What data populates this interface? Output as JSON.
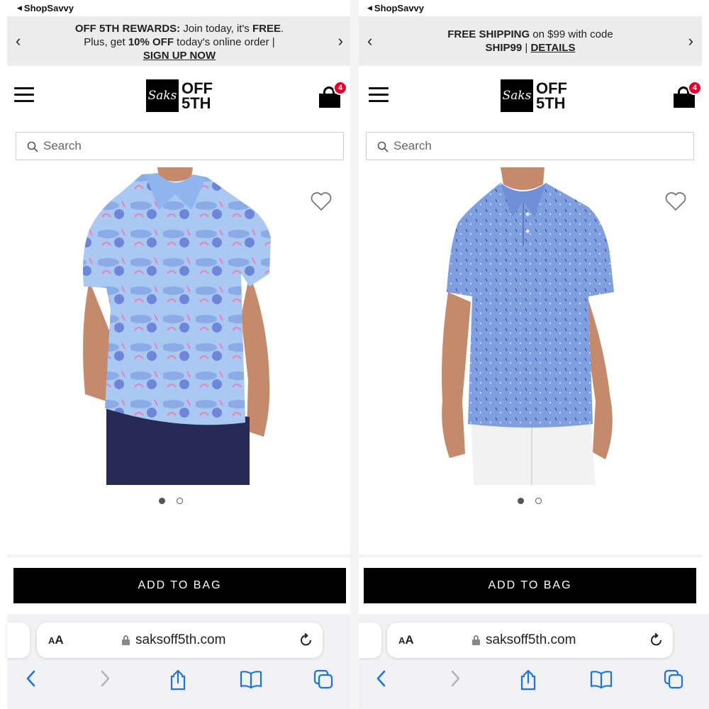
{
  "status_bar": {
    "back_app": "ShopSavvy"
  },
  "panels": [
    {
      "promo": {
        "line1_bold": "OFF 5TH REWARDS:",
        "line1_rest": " Join today, it's ",
        "line1_bold2": "FREE",
        "line1_end": ".",
        "line2_start": "Plus, get ",
        "line2_bold": "10% OFF",
        "line2_rest": " today's online order |",
        "link": "SIGN UP NOW"
      },
      "header": {
        "logo_script": "Saks",
        "logo_line1": "OFF",
        "logo_line2": "5TH",
        "cart_count": "4"
      },
      "search": {
        "placeholder": "Search"
      },
      "product": {
        "shirt_color": "#9fc2ef",
        "pattern": "flamingo print polo",
        "pages": 2,
        "current_page": 1
      },
      "add_to_bag": "ADD TO BAG",
      "browser": {
        "aa": "AA",
        "url": "saksoff5th.com"
      }
    },
    {
      "promo": {
        "line1_bold": "FREE SHIPPING",
        "line1_rest": " on $99 with code",
        "line2_bold": "SHIP99",
        "line2_rest": " | ",
        "link": "DETAILS"
      },
      "header": {
        "logo_script": "Saks",
        "logo_line1": "OFF",
        "logo_line2": "5TH",
        "cart_count": "4"
      },
      "search": {
        "placeholder": "Search"
      },
      "product": {
        "shirt_color": "#7f9fe0",
        "pattern": "micro print polo",
        "pages": 2,
        "current_page": 1
      },
      "add_to_bag": "ADD TO BAG",
      "browser": {
        "aa": "AA",
        "url": "saksoff5th.com"
      }
    }
  ],
  "colors": {
    "badge": "#e4002b",
    "browser_blue": "#1a73e8",
    "promo_bg": "#ececec"
  },
  "icons": [
    "back-arrow-icon",
    "chevron-left-icon",
    "chevron-right-icon",
    "hamburger-icon",
    "shopping-bag-icon",
    "search-icon",
    "heart-icon",
    "lock-icon",
    "reload-icon",
    "share-icon",
    "bookmarks-icon",
    "tabs-icon"
  ]
}
